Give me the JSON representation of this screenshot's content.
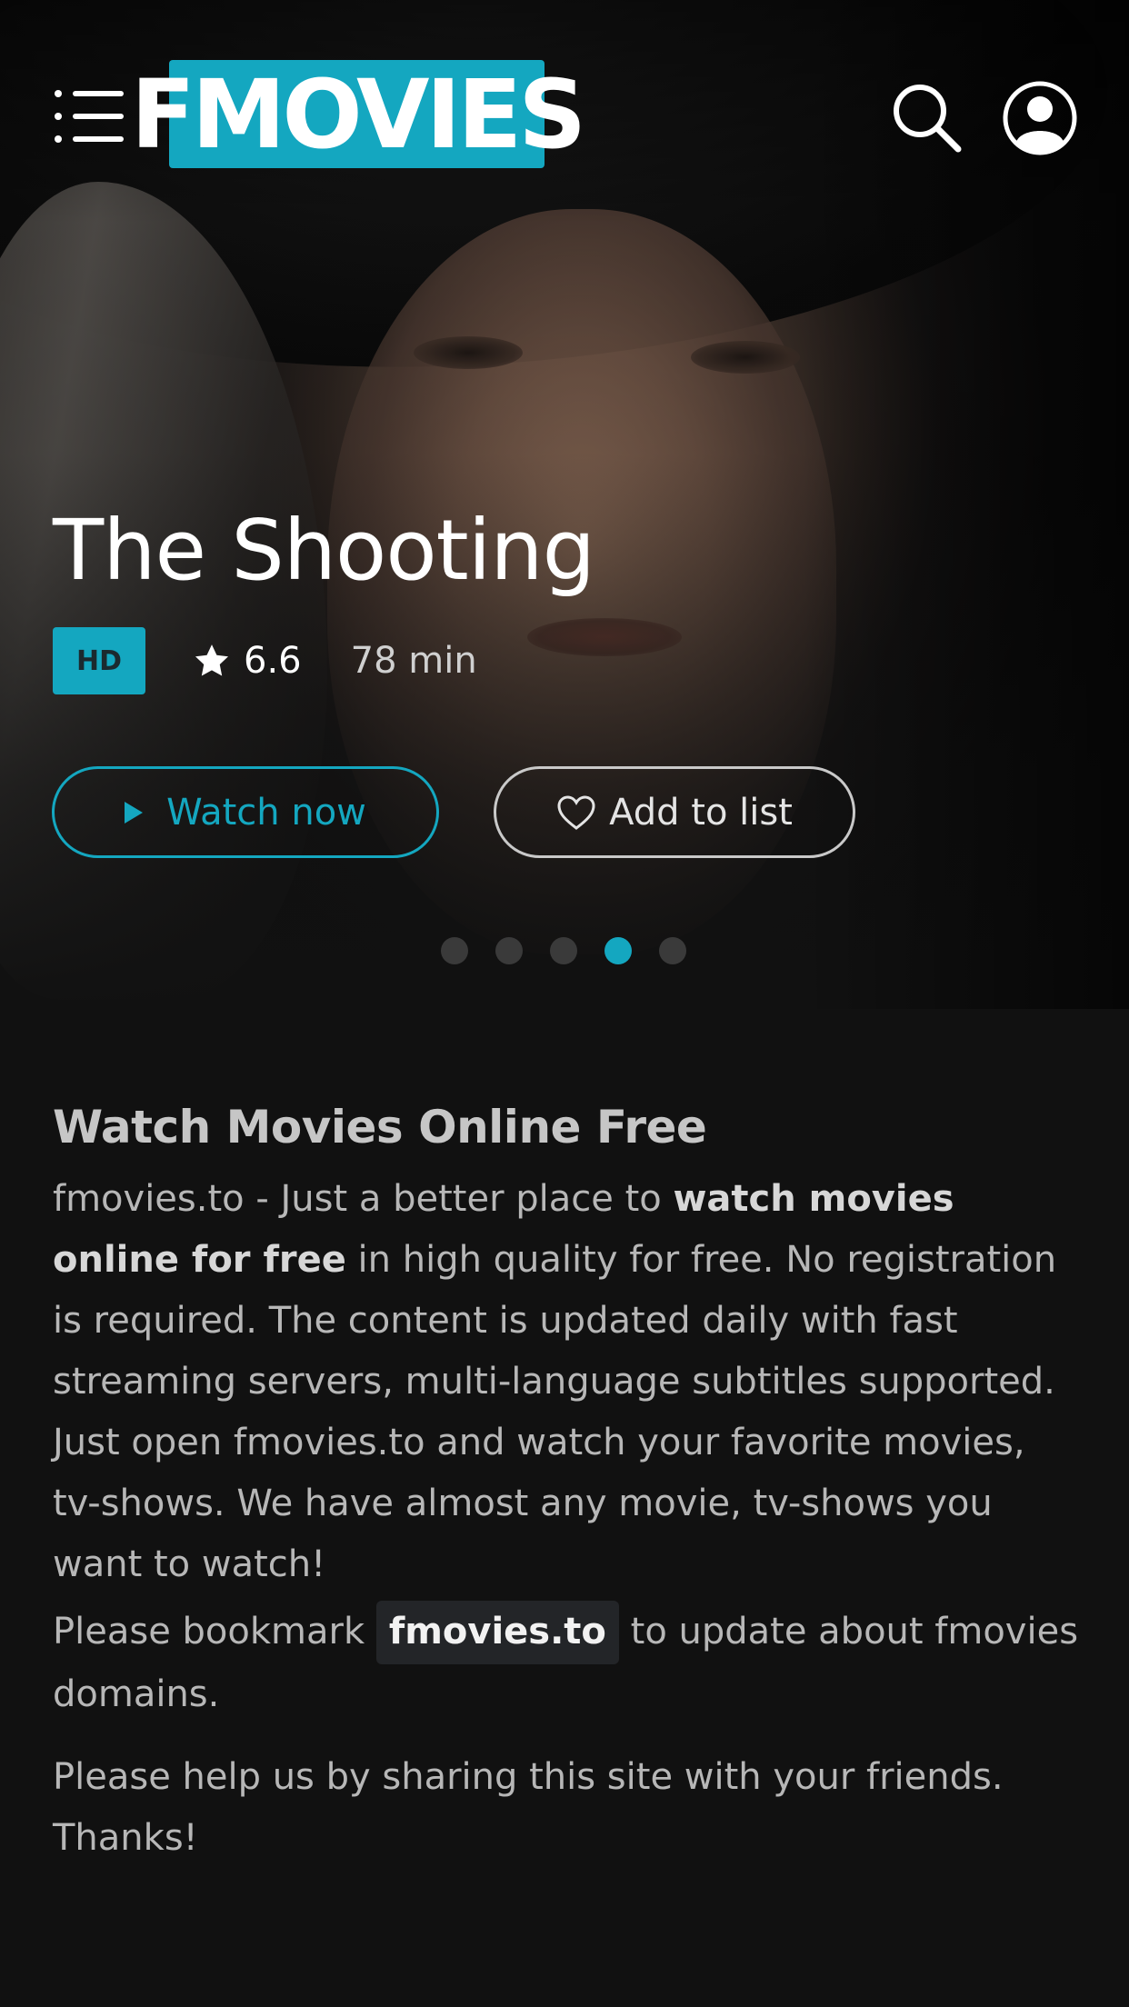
{
  "header": {
    "logo_text": "FMOVIES",
    "menu_icon": "menu-list-icon",
    "search_icon": "search-icon",
    "user_icon": "user-circle-icon"
  },
  "hero": {
    "title": "The Shooting",
    "quality_badge": "HD",
    "rating": "6.6",
    "duration": "78 min",
    "watch_button": "Watch now",
    "add_button": "Add to list",
    "slides_total": 5,
    "slide_active_index": 3
  },
  "about": {
    "heading": "Watch Movies Online Free",
    "para1_part1": "fmovies.to - Just a better place to ",
    "para1_bold": "watch movies online for free",
    "para1_part2": " in high quality for free. No registration is required. The content is updated daily with fast streaming servers, multi-language subtitles supported. Just open fmovies.to and watch your favorite movies, tv-shows. We have almost any movie, tv-shows you want to watch!",
    "para2_part1": "Please bookmark ",
    "para2_domain": "fmovies.to",
    "para2_part2": " to update about fmovies domains.",
    "para3": "Please help us by sharing this site with your friends. Thanks!"
  },
  "colors": {
    "accent": "#14a7c0",
    "background": "#111111"
  }
}
